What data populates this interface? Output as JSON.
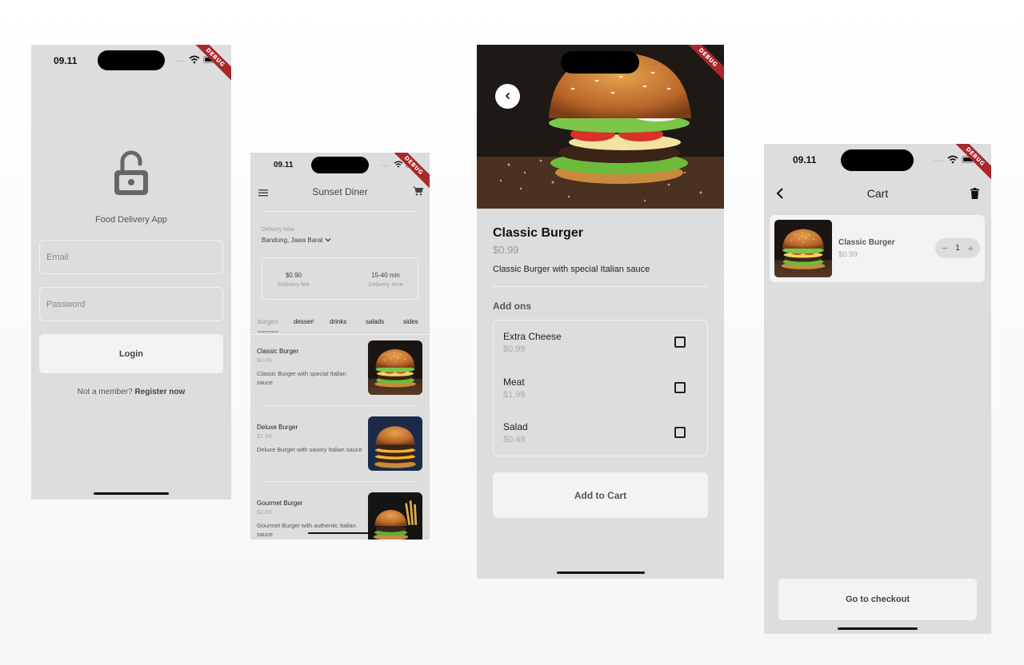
{
  "status": {
    "time": "09.11",
    "dots": "....",
    "debug": "DEBUG"
  },
  "login": {
    "app_title": "Food Delivery App",
    "email_placeholder": "Email",
    "password_placeholder": "Password",
    "login_label": "Login",
    "not_member": "Not a member?",
    "register_label": "Register now"
  },
  "menu": {
    "title": "Sunset Diner",
    "deliver_label": "Delivery Now",
    "deliver_location": "Bandung, Jawa Barat",
    "delivery_fee_value": "$0.90",
    "delivery_fee_label": "Delivery fee",
    "delivery_time_value": "15-40 min",
    "delivery_time_label": "Delivery time",
    "tabs": [
      "burgers",
      "desserts",
      "drinks",
      "salads",
      "sides"
    ],
    "items": [
      {
        "name": "Classic Burger",
        "price": "$0.99",
        "desc": "Classic Burger with special Italian sauce"
      },
      {
        "name": "Deluxe Burger",
        "price": "$1.99",
        "desc": "Deluxe Burger with savory Italian sauce"
      },
      {
        "name": "Gourmet Burger",
        "price": "$2.99",
        "desc": "Gourmet Burger with authentic Italian sauce"
      }
    ]
  },
  "detail": {
    "title": "Classic Burger",
    "price": "$0.99",
    "description": "Classic Burger with special Italian sauce",
    "addons_title": "Add ons",
    "addons": [
      {
        "name": "Extra Cheese",
        "price": "$0.99",
        "checked": false
      },
      {
        "name": "Meat",
        "price": "$1.99",
        "checked": false
      },
      {
        "name": "Salad",
        "price": "$0.49",
        "checked": false
      }
    ],
    "add_to_cart_label": "Add to Cart"
  },
  "cart": {
    "title": "Cart",
    "item": {
      "name": "Classic Burger",
      "price": "$0.99",
      "quantity": "1"
    },
    "minus": "−",
    "plus": "+",
    "checkout_label": "Go to checkout"
  },
  "colors": {
    "screen_bg": "#dddddd",
    "button_bg": "#f3f3f3",
    "debug_ribbon": "#a8282b"
  }
}
